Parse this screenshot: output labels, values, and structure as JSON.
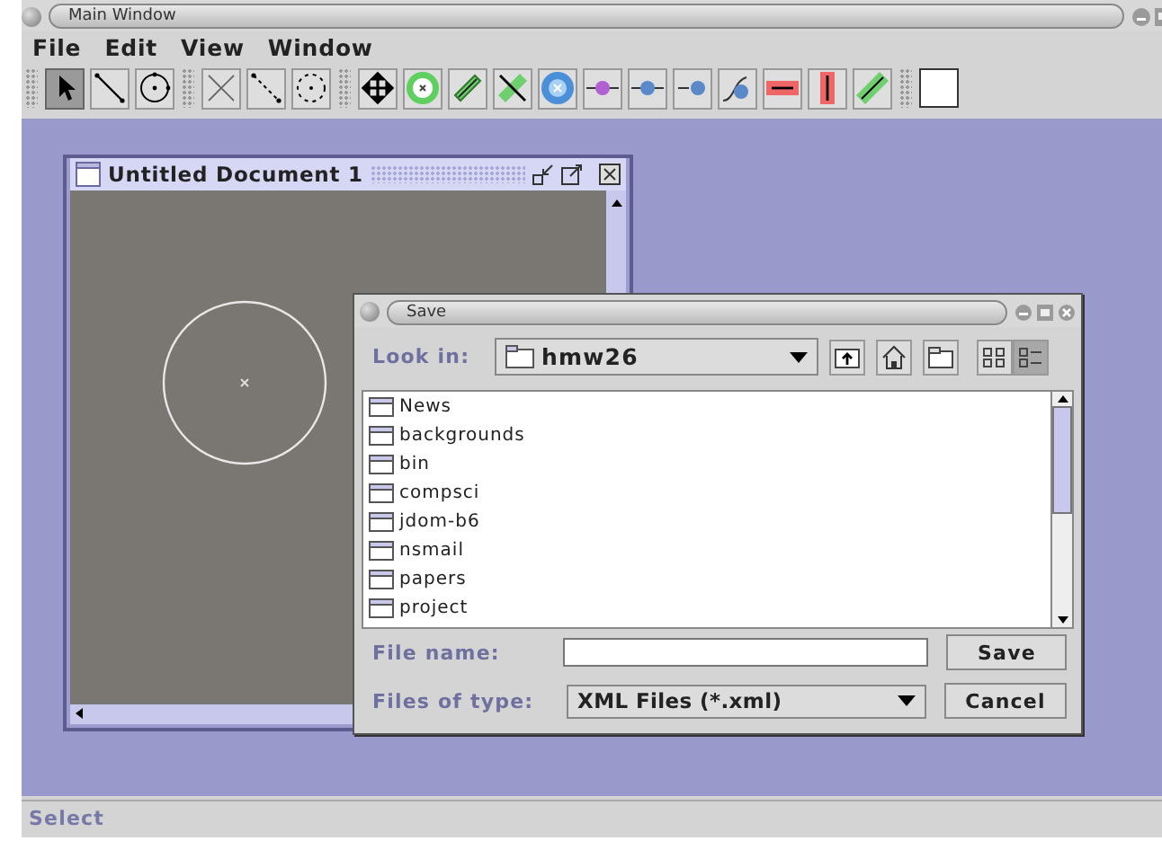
{
  "window": {
    "title": "Main Window"
  },
  "menu": [
    {
      "label": "File"
    },
    {
      "label": "Edit"
    },
    {
      "label": "View"
    },
    {
      "label": "Window"
    }
  ],
  "toolbar": {
    "groups": [
      [
        {
          "kind": "pointer",
          "selected": true
        },
        {
          "kind": "line",
          "selected": false
        },
        {
          "kind": "circle",
          "selected": false
        }
      ],
      [
        {
          "kind": "point",
          "selected": false
        },
        {
          "kind": "dashed-line",
          "selected": false
        },
        {
          "kind": "dashed-circle",
          "selected": false
        }
      ],
      [
        {
          "kind": "move",
          "selected": false
        },
        {
          "kind": "green-node",
          "selected": false
        },
        {
          "kind": "green-bar",
          "selected": false
        },
        {
          "kind": "green-cross",
          "selected": false
        },
        {
          "kind": "blue-node",
          "selected": false
        },
        {
          "kind": "purple-link",
          "selected": false
        },
        {
          "kind": "blue-link",
          "selected": false
        },
        {
          "kind": "blue-end",
          "selected": false
        },
        {
          "kind": "curve-node",
          "selected": false
        },
        {
          "kind": "red-horizontal",
          "selected": false
        },
        {
          "kind": "red-vertical",
          "selected": false
        },
        {
          "kind": "green-diagonal",
          "selected": false
        }
      ]
    ]
  },
  "document": {
    "title": "Untitled Document 1"
  },
  "save_dialog": {
    "title": "Save",
    "look_in_label": "Look in:",
    "look_in_value": "hmw26",
    "files": [
      {
        "name": "News"
      },
      {
        "name": "backgrounds"
      },
      {
        "name": "bin"
      },
      {
        "name": "compsci"
      },
      {
        "name": "jdom-b6"
      },
      {
        "name": "nsmail"
      },
      {
        "name": "papers"
      },
      {
        "name": "project"
      }
    ],
    "view_buttons": [
      {
        "kind": "list",
        "selected": false
      },
      {
        "kind": "details",
        "selected": true
      }
    ],
    "file_name_label": "File name:",
    "file_type_label": "Files of type:",
    "file_type_value": "XML Files (*.xml)",
    "buttons": [
      {
        "label": "Save"
      },
      {
        "label": "Cancel"
      }
    ]
  },
  "status_bar": {
    "text": "Select"
  }
}
